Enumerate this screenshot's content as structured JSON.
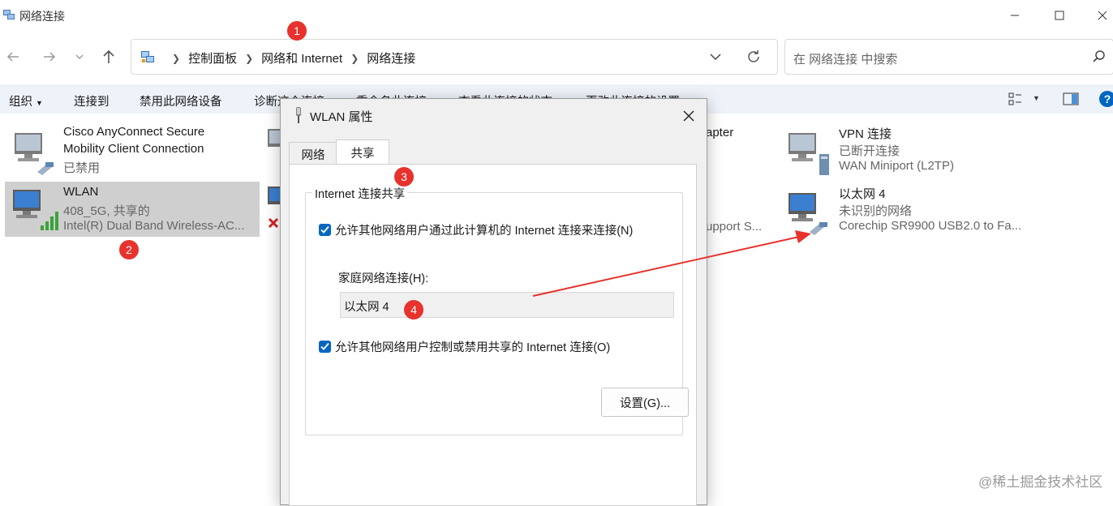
{
  "window": {
    "title": "网络连接"
  },
  "address": {
    "crumbs": [
      "控制面板",
      "网络和 Internet",
      "网络连接"
    ]
  },
  "search": {
    "placeholder": "在 网络连接 中搜索"
  },
  "commands": [
    "组织",
    "连接到",
    "禁用此网络设备",
    "诊断这个连接",
    "重命名此连接",
    "查看此连接的状态",
    "更改此连接的设置"
  ],
  "connections": [
    {
      "name": "Cisco AnyConnect Secure",
      "line2": "Mobility Client Connection",
      "line3": "已禁用"
    },
    {
      "name": "WLAN",
      "line2": "408_5G, 共享的",
      "line3": "Intel(R) Dual Band Wireless-AC..."
    },
    {
      "name": "apter",
      "line2": "",
      "line3": ""
    },
    {
      "name": "upport S...",
      "line2": "",
      "line3": ""
    },
    {
      "name": "VPN 连接",
      "line2": "已断开连接",
      "line3": "WAN Miniport (L2TP)"
    },
    {
      "name": "以太网 4",
      "line2": "未识别的网络",
      "line3": "Corechip SR9900 USB2.0 to Fa..."
    }
  ],
  "dialog": {
    "title": "WLAN 属性",
    "tabs": [
      "网络",
      "共享"
    ],
    "group_label": "Internet 连接共享",
    "allow_label": "允许其他网络用户通过此计算机的 Internet 连接来连接(N)",
    "home_label": "家庭网络连接(H):",
    "home_value": "以太网 4",
    "control_label": "允许其他网络用户控制或禁用共享的 Internet 连接(O)",
    "settings_button": "设置(G)...",
    "allow_checked": true,
    "control_checked": true
  },
  "markers": [
    "1",
    "2",
    "3",
    "4"
  ],
  "watermark": "@稀土掘金技术社区",
  "colors": {
    "accent": "#0067c0",
    "marker": "#e8322d",
    "cmdbar": "#eef3f9",
    "selection": "#cfcfcf"
  }
}
